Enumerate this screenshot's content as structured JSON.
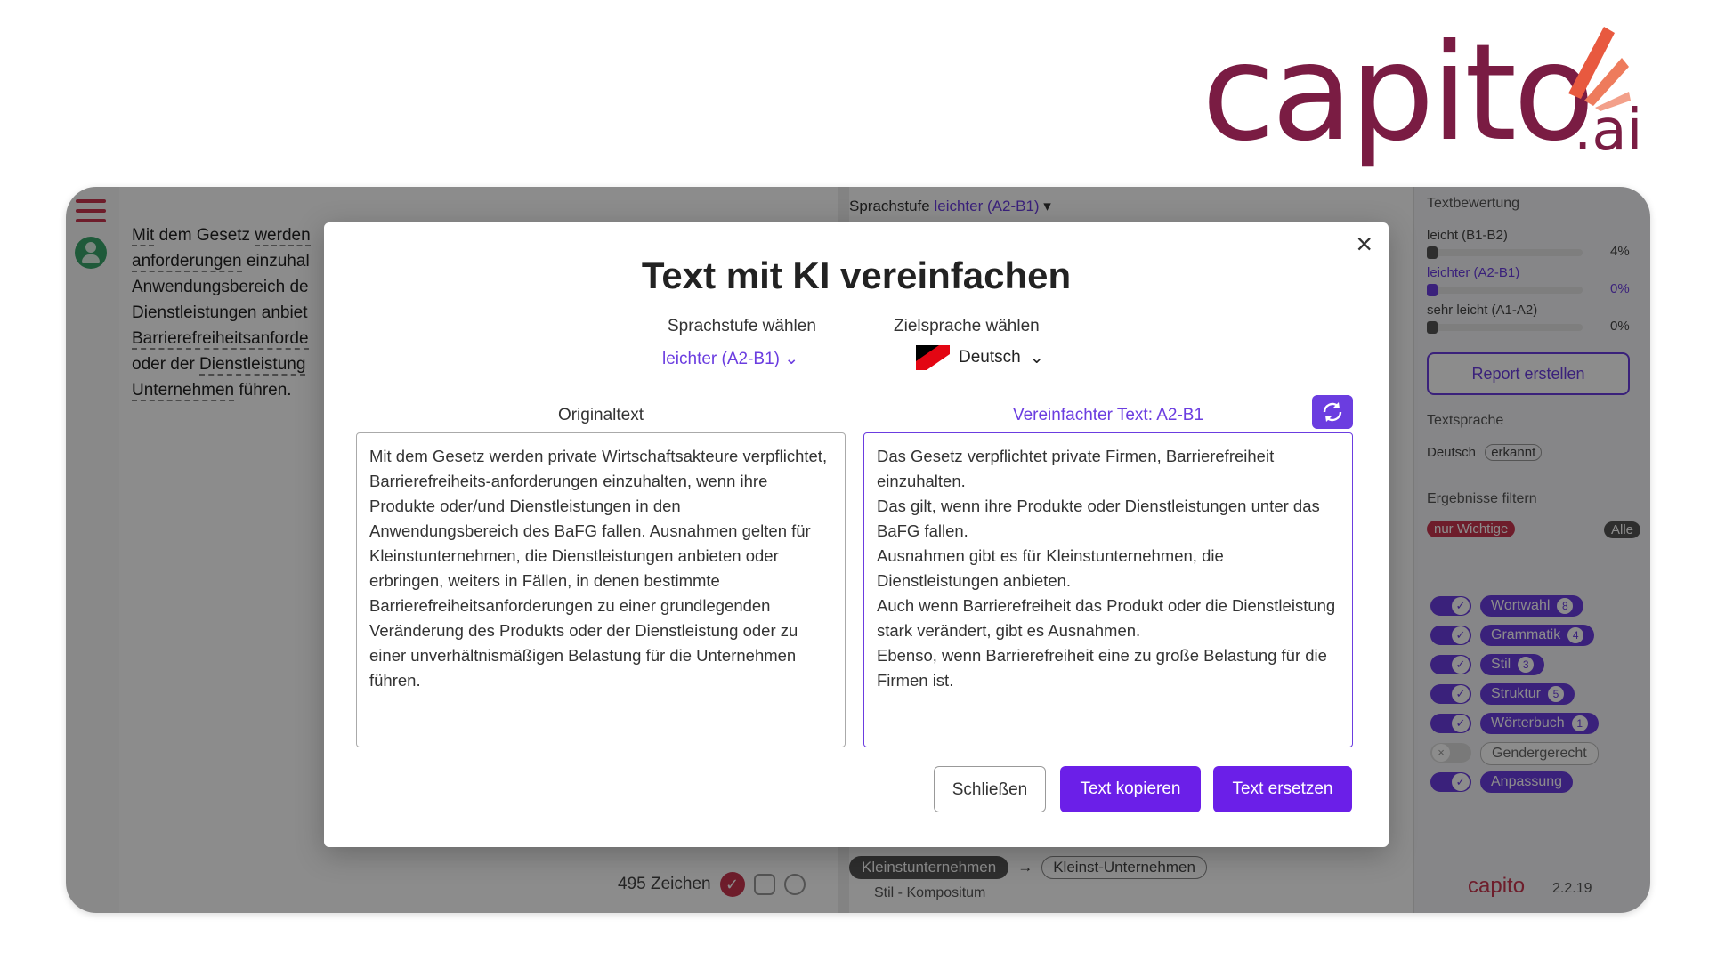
{
  "logo": {
    "word": "capito",
    "suffix": ".ai",
    "color": "#7a1c43"
  },
  "editor": {
    "lines": [
      [
        "Mit",
        " dem Gesetz ",
        "werden",
        ""
      ],
      [
        "anforderungen",
        " einzuhal",
        "",
        ""
      ],
      [
        "Anwendungsbereich de",
        "",
        "",
        ""
      ],
      [
        "Dienstleistungen anbiet",
        "",
        "",
        ""
      ],
      [
        "Barrierefreiheitsanforde",
        "",
        "",
        ""
      ],
      [
        "oder der ",
        "Dienstleistung",
        "",
        ""
      ],
      [
        "Unternehmen",
        " führen.",
        "",
        ""
      ]
    ],
    "char_count": "495 Zeichen"
  },
  "middle": {
    "level_label": "Sprachstufe",
    "level_value": "leichter (A2-B1)",
    "suggestion_from": "Kleinstunternehmen",
    "suggestion_to": "Kleinst-Unternehmen",
    "suggestion_type": "Stil - Kompositum"
  },
  "sidebar": {
    "rating_title": "Textbewertung",
    "ratings": [
      {
        "label": "leicht (B1-B2)",
        "pct": "4%"
      },
      {
        "label": "leichter (A2-B1)",
        "pct": "0%"
      },
      {
        "label": "sehr leicht (A1-A2)",
        "pct": "0%"
      }
    ],
    "report_button": "Report erstellen",
    "language_title": "Textsprache",
    "language_value": "Deutsch",
    "language_badge": "erkannt",
    "filter_title": "Ergebnisse filtern",
    "filter_important": "nur Wichtige",
    "filter_all": "Alle",
    "filters": [
      {
        "label": "Wortwahl",
        "count": "8",
        "on": true
      },
      {
        "label": "Grammatik",
        "count": "4",
        "on": true
      },
      {
        "label": "Stil",
        "count": "3",
        "on": true
      },
      {
        "label": "Struktur",
        "count": "5",
        "on": true
      },
      {
        "label": "Wörterbuch",
        "count": "1",
        "on": true
      },
      {
        "label": "Gendergerecht",
        "count": "",
        "on": false
      },
      {
        "label": "Anpassung",
        "count": "",
        "on": true
      }
    ],
    "brand": "capito",
    "version": "2.2.19"
  },
  "modal": {
    "title": "Text mit KI vereinfachen",
    "level_label": "Sprachstufe wählen",
    "level_value": "leichter (A2-B1)",
    "lang_label": "Zielsprache wählen",
    "lang_value": "Deutsch",
    "original_heading": "Originaltext",
    "simplified_heading": "Vereinfachter Text: A2-B1",
    "original_text": "Mit dem Gesetz werden private Wirtschaftsakteure verpflichtet, Barrierefreiheits-anforderungen einzuhalten, wenn ihre Produkte oder/und Dienstleistungen in den Anwendungsbereich des BaFG fallen. Ausnahmen gelten für Kleinstunternehmen, die Dienstleistungen anbieten oder erbringen, weiters in Fällen, in denen bestimmte Barrierefreiheitsanforderungen zu einer grundlegenden Veränderung des Produkts oder der Dienstleistung oder zu einer unverhältnismäßigen Belastung für die Unternehmen führen.",
    "simplified_text": "Das Gesetz verpflichtet private Firmen, Barrierefreiheit einzuhalten.\nDas gilt, wenn ihre Produkte oder Dienstleistungen unter das BaFG fallen.\nAusnahmen gibt es für Kleinstunternehmen, die Dienstleistungen anbieten.\nAuch wenn Barrierefreiheit das Produkt oder die Dienstleistung stark verändert, gibt es Ausnahmen.\nEbenso, wenn Barrierefreiheit eine zu große Belastung für die Firmen ist.",
    "btn_close": "Schließen",
    "btn_copy": "Text kopieren",
    "btn_replace": "Text ersetzen"
  },
  "colors": {
    "accent": "#6b1fe8",
    "brand": "#7a1c43",
    "danger": "#c9364f"
  }
}
